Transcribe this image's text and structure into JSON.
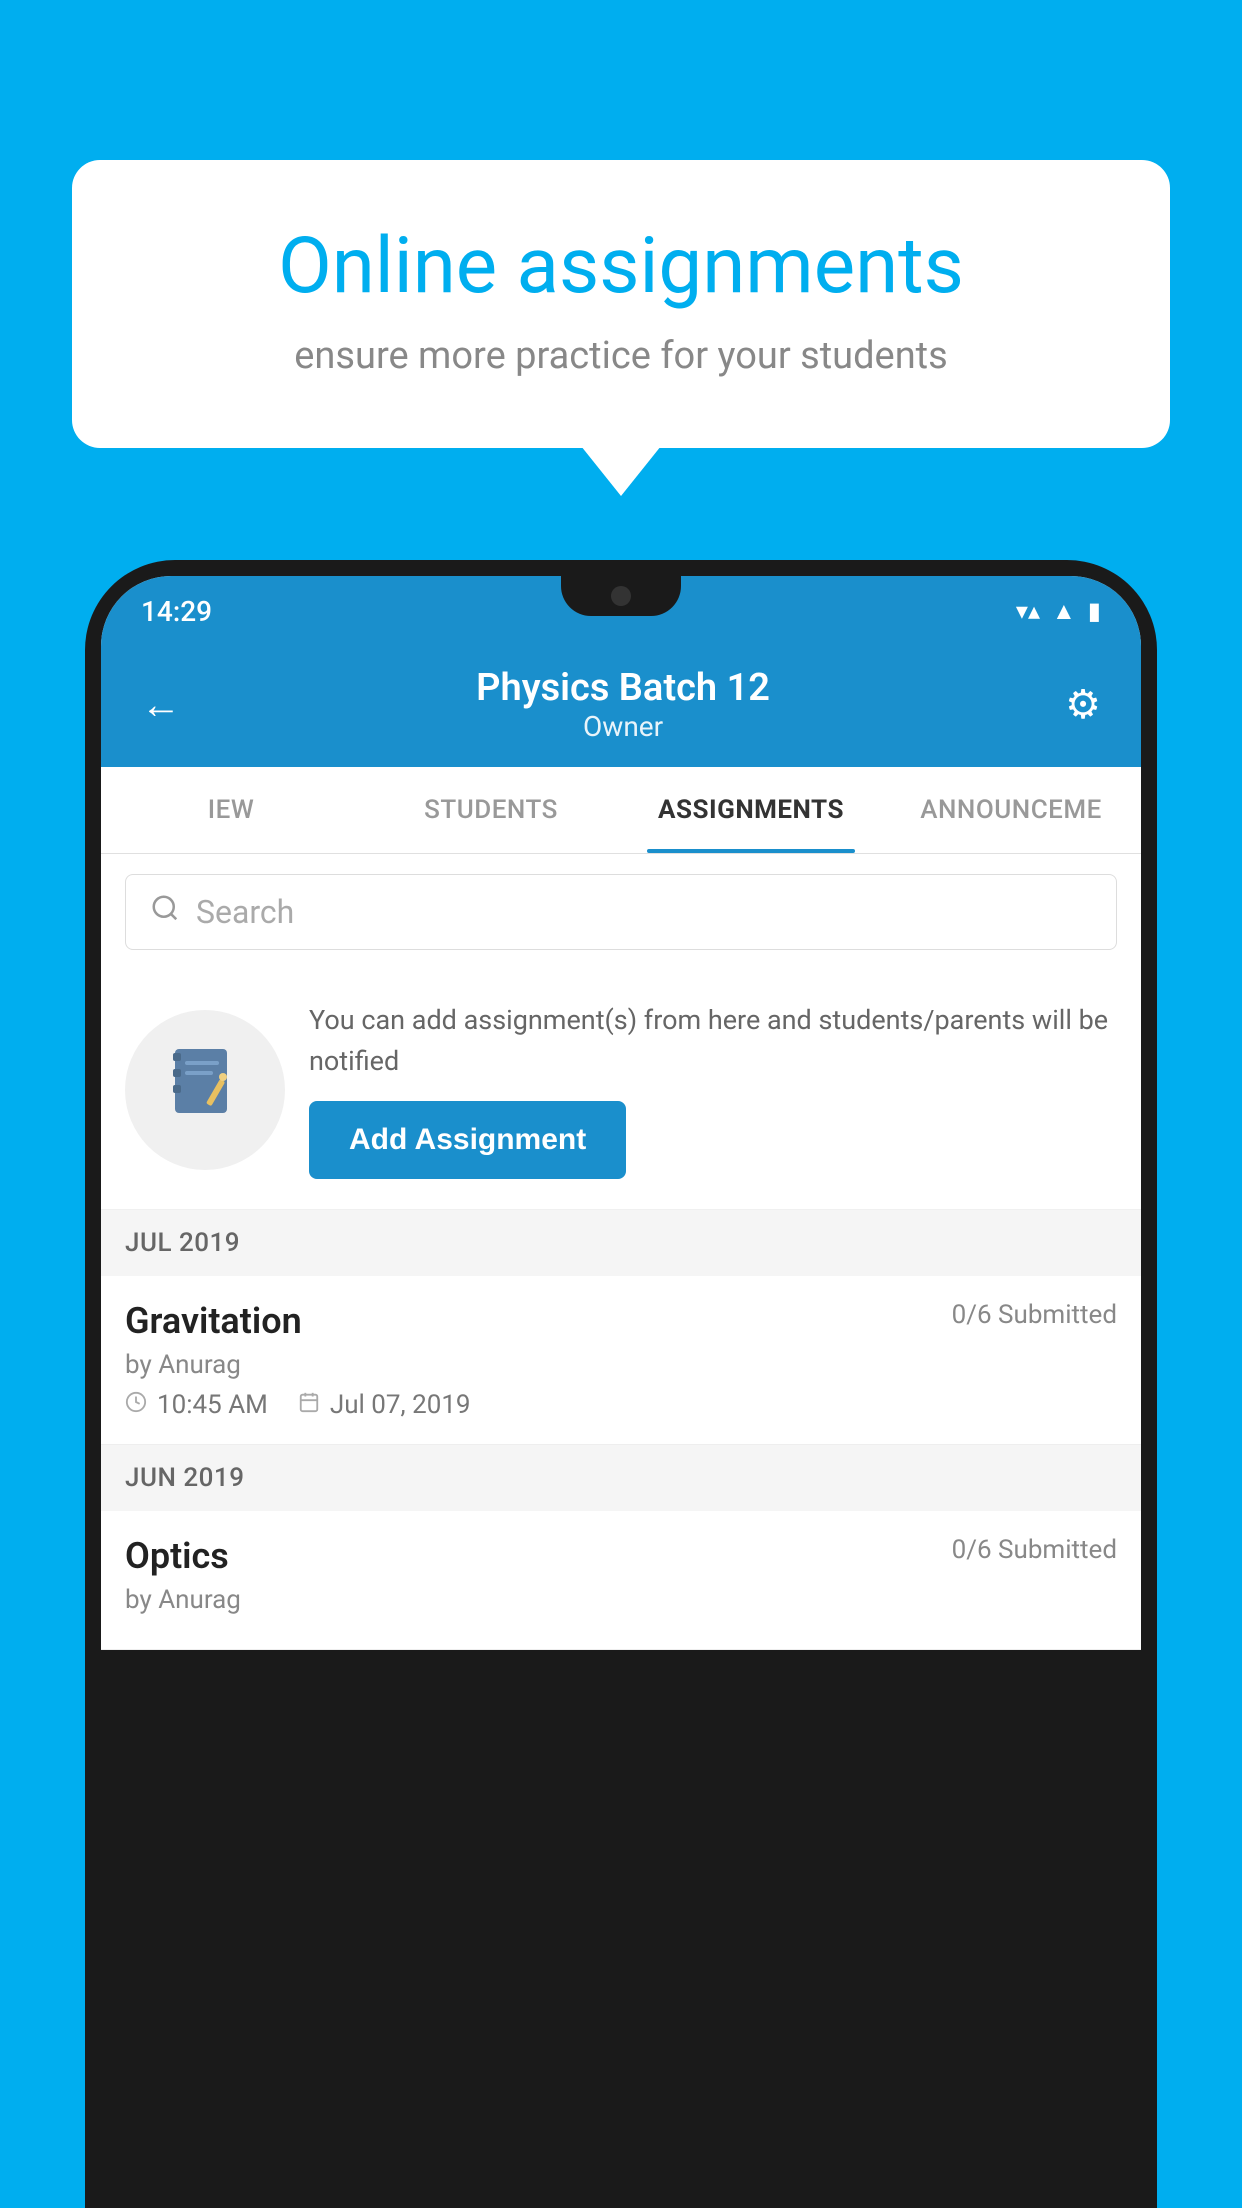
{
  "background_color": "#00AEEF",
  "speech_bubble": {
    "title": "Online assignments",
    "subtitle": "ensure more practice for your students"
  },
  "status_bar": {
    "time": "14:29",
    "wifi_icon": "wifi",
    "signal_icon": "signal",
    "battery_icon": "battery"
  },
  "header": {
    "title": "Physics Batch 12",
    "subtitle": "Owner",
    "back_label": "←",
    "settings_label": "⚙"
  },
  "tabs": [
    {
      "label": "IEW",
      "active": false
    },
    {
      "label": "STUDENTS",
      "active": false
    },
    {
      "label": "ASSIGNMENTS",
      "active": true
    },
    {
      "label": "ANNOUNCEME",
      "active": false
    }
  ],
  "search": {
    "placeholder": "Search"
  },
  "promo": {
    "description": "You can add assignment(s) from here and students/parents will be notified",
    "button_label": "Add Assignment"
  },
  "sections": [
    {
      "label": "JUL 2019",
      "assignments": [
        {
          "name": "Gravitation",
          "status": "0/6 Submitted",
          "author": "by Anurag",
          "time": "10:45 AM",
          "date": "Jul 07, 2019"
        }
      ]
    },
    {
      "label": "JUN 2019",
      "assignments": [
        {
          "name": "Optics",
          "status": "0/6 Submitted",
          "author": "by Anurag",
          "time": "",
          "date": ""
        }
      ]
    }
  ]
}
